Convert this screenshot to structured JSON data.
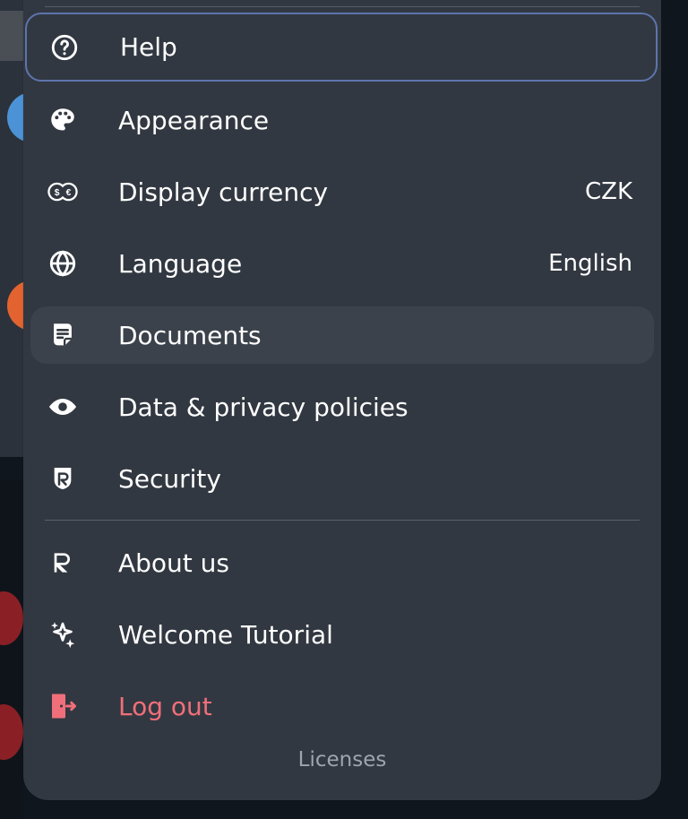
{
  "menu": {
    "items": [
      {
        "id": "help",
        "label": "Help",
        "icon": "help-circle-icon"
      },
      {
        "id": "appearance",
        "label": "Appearance",
        "icon": "palette-icon"
      },
      {
        "id": "display_currency",
        "label": "Display currency",
        "value": "CZK",
        "icon": "currency-icon"
      },
      {
        "id": "language",
        "label": "Language",
        "value": "English",
        "icon": "globe-icon"
      },
      {
        "id": "documents",
        "label": "Documents",
        "icon": "document-icon"
      },
      {
        "id": "privacy",
        "label": "Data & privacy policies",
        "icon": "eye-icon"
      },
      {
        "id": "security",
        "label": "Security",
        "icon": "shield-r-icon"
      },
      {
        "id": "about",
        "label": "About us",
        "icon": "r-logo-icon"
      },
      {
        "id": "tutorial",
        "label": "Welcome Tutorial",
        "icon": "sparkle-icon"
      },
      {
        "id": "logout",
        "label": "Log out",
        "icon": "logout-icon"
      }
    ],
    "footer": "Licenses"
  },
  "colors": {
    "panel": "#323841",
    "highlight": "#3c424b",
    "focus_border": "#5d74ad",
    "danger": "#f06f7a"
  }
}
